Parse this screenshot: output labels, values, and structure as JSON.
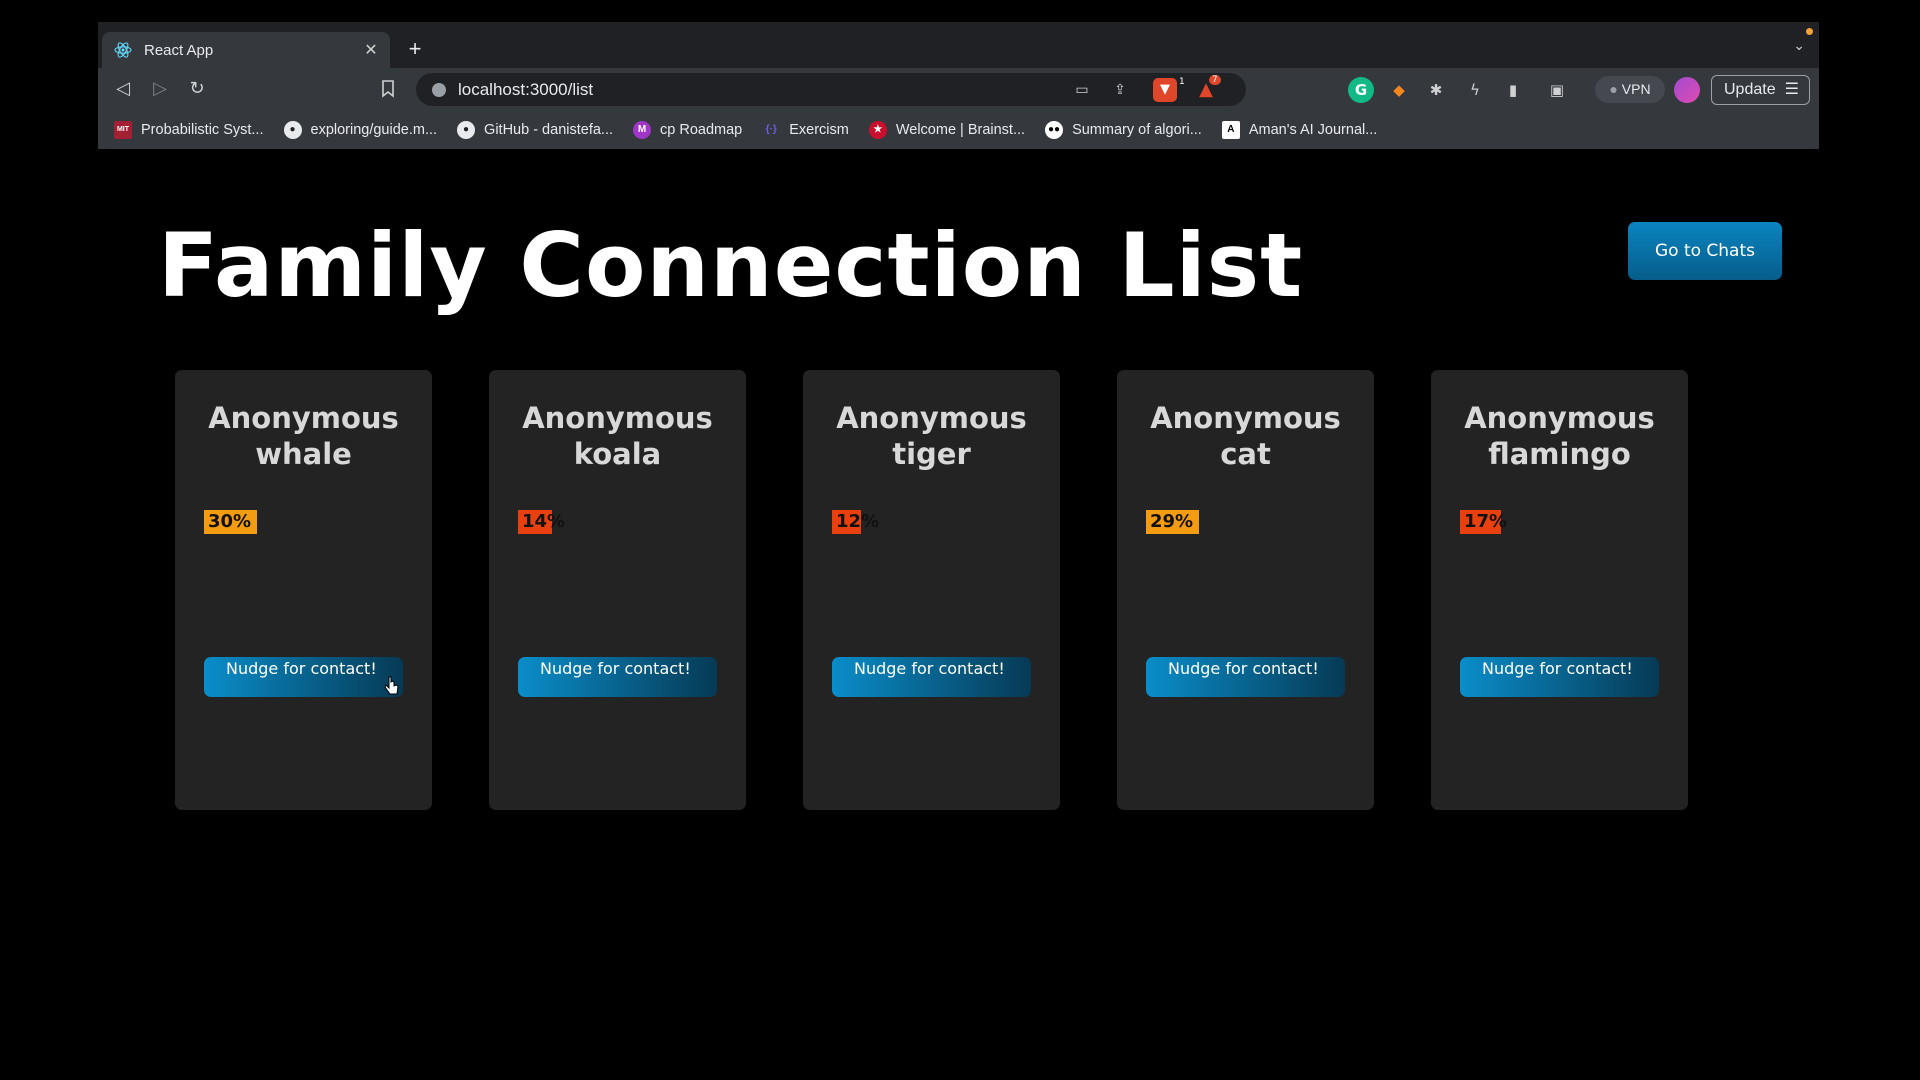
{
  "browser": {
    "tab_title": "React App",
    "url": "localhost:3000/list",
    "vpn_label": "VPN",
    "update_label": "Update",
    "brave_badge": "1",
    "rewards_badge": "7",
    "bookmarks": [
      {
        "label": "Probabilistic Syst...",
        "icon": "mit-ocw-icon"
      },
      {
        "label": "exploring/guide.m...",
        "icon": "github-icon"
      },
      {
        "label": "GitHub - danistefa...",
        "icon": "github-icon"
      },
      {
        "label": "cp Roadmap",
        "icon": "m-icon"
      },
      {
        "label": "Exercism",
        "icon": "exercism-icon"
      },
      {
        "label": "Welcome | Brainst...",
        "icon": "star-icon"
      },
      {
        "label": "Summary of algori...",
        "icon": "medium-icon"
      },
      {
        "label": "Aman's AI Journal...",
        "icon": "a-icon"
      }
    ]
  },
  "page": {
    "title": "Family Connection List",
    "chats_button": "Go to Chats",
    "colors": {
      "high": "#f39c12",
      "low": "#e8410f",
      "button": "#0a8dc9"
    },
    "cards": [
      {
        "name_line1": "Anonymous",
        "name_line2": "whale",
        "percent": 30,
        "percent_label": "30%",
        "button": "Nudge for contact!"
      },
      {
        "name_line1": "Anonymous",
        "name_line2": "koala",
        "percent": 14,
        "percent_label": "14%",
        "button": "Nudge for contact!"
      },
      {
        "name_line1": "Anonymous",
        "name_line2": "tiger",
        "percent": 12,
        "percent_label": "12%",
        "button": "Nudge for contact!"
      },
      {
        "name_line1": "Anonymous",
        "name_line2": "cat",
        "percent": 29,
        "percent_label": "29%",
        "button": "Nudge for contact!"
      },
      {
        "name_line1": "Anonymous",
        "name_line2": "flamingo",
        "percent": 17,
        "percent_label": "17%",
        "button": "Nudge for contact!"
      }
    ]
  }
}
